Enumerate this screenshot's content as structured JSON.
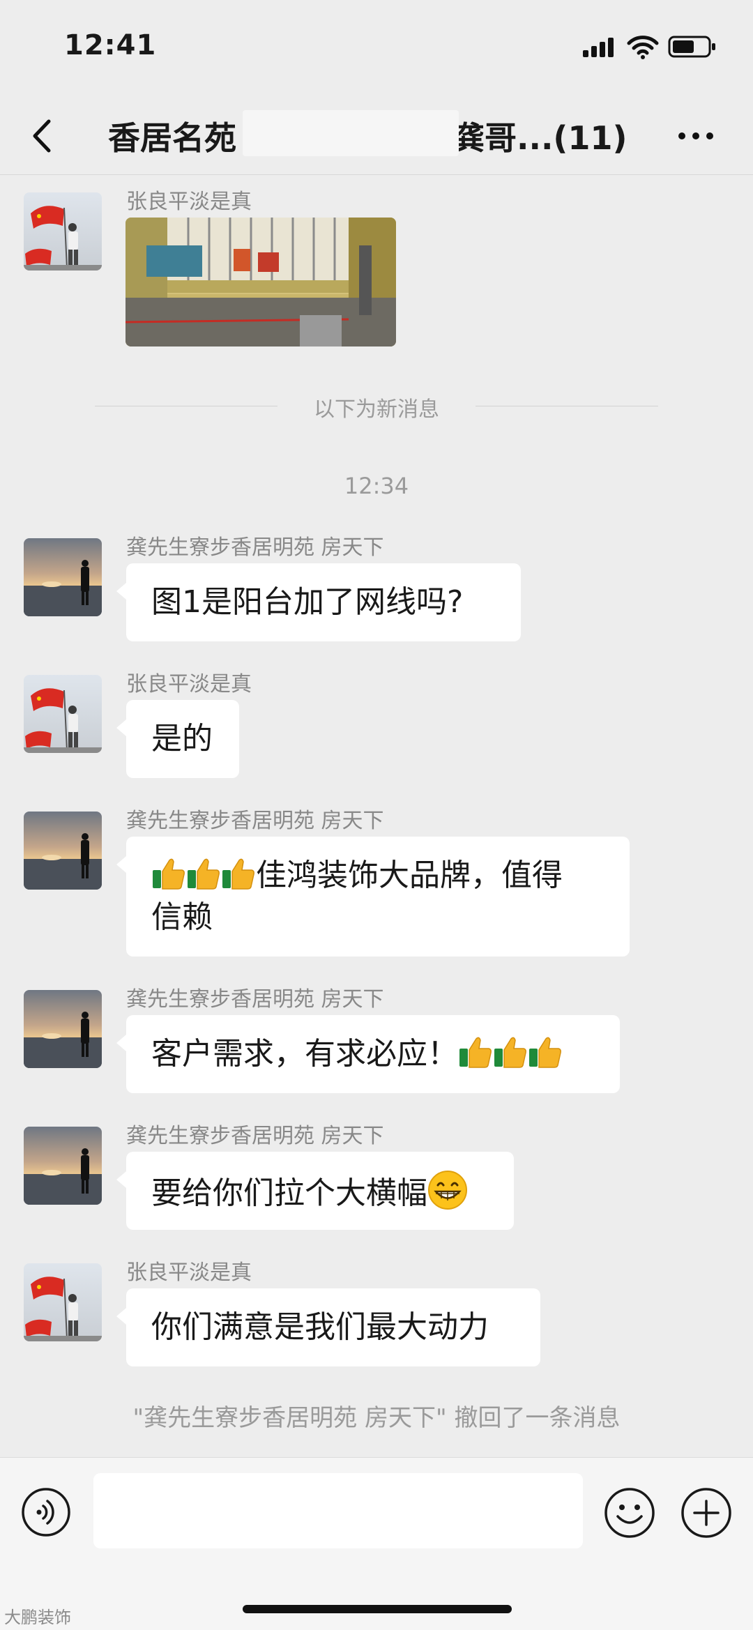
{
  "status_bar": {
    "time": "12:41"
  },
  "nav": {
    "title_left": "香居名苑",
    "title_right": "龚哥...(11)"
  },
  "divider": {
    "new_messages": "以下为新消息"
  },
  "time_stamp": "12:34",
  "messages": [
    {
      "sender": "张良平淡是真",
      "type": "image"
    },
    {
      "sender": "龚先生寮步香居明苑 房天下",
      "text": "图1是阳台加了网线吗?"
    },
    {
      "sender": "张良平淡是真",
      "text": "是的"
    },
    {
      "sender": "龚先生寮步香居明苑 房天下",
      "text_line1": "佳鸿装饰大品牌，值得",
      "text_line2": "信赖",
      "emoji": "thumbs-up"
    },
    {
      "sender": "龚先生寮步香居明苑 房天下",
      "text": "客户需求，有求必应！",
      "emoji": "thumbs-up"
    },
    {
      "sender": "龚先生寮步香居明苑 房天下",
      "text": "要给你们拉个大横幅",
      "emoji": "grinning-face"
    },
    {
      "sender": "张良平淡是真",
      "text": "你们满意是我们最大动力"
    }
  ],
  "recall_notice": "\"龚先生寮步香居明苑 房天下\" 撤回了一条消息",
  "input": {
    "placeholder": ""
  },
  "watermark": "大鹏装饰",
  "colors": {
    "background": "#ededed",
    "bubble": "#ffffff",
    "meta_text": "#9a9a9a"
  }
}
